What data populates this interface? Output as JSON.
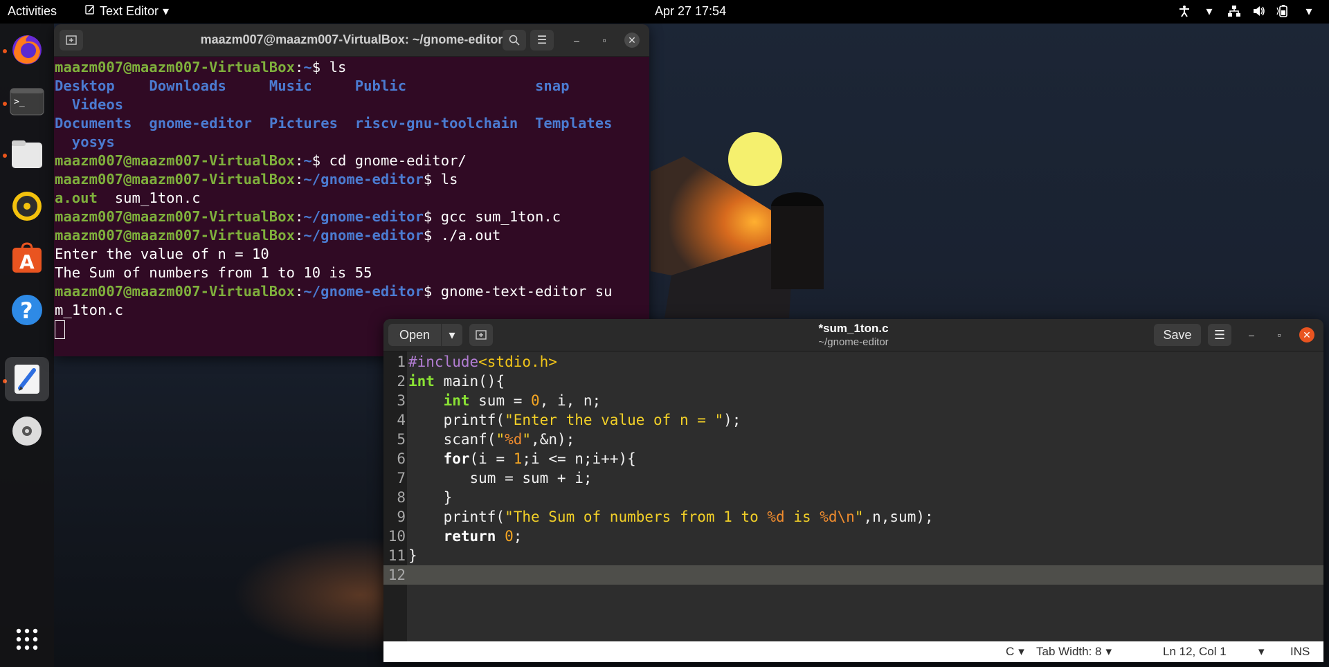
{
  "topbar": {
    "activities": "Activities",
    "app_name": "Text Editor",
    "clock": "Apr 27  17:54"
  },
  "dock": {
    "items": [
      "firefox-icon",
      "terminal-icon",
      "files-icon",
      "rhythmbox-icon",
      "software-icon",
      "help-icon",
      "text-editor-icon",
      "disc-icon",
      "app-grid-icon"
    ]
  },
  "terminal": {
    "title": "maazm007@maazm007-VirtualBox: ~/gnome-editor",
    "prompt_user": "maazm007@maazm007-VirtualBox",
    "home_path": "~",
    "editor_path": "~/gnome-editor",
    "lines": {
      "cmd1": "ls",
      "ls_row1": [
        "Desktop",
        "Downloads",
        "Music",
        "Public",
        "snap"
      ],
      "ls_row1_wrap": "Videos",
      "ls_row2": [
        "Documents",
        "gnome-editor",
        "Pictures",
        "riscv-gnu-toolchain",
        "Templates"
      ],
      "ls_row2_wrap": "yosys",
      "cmd2": "cd gnome-editor/",
      "cmd3": "ls",
      "ls3_exe": "a.out",
      "ls3_file": "sum_1ton.c",
      "cmd4": "gcc sum_1ton.c",
      "cmd5": "./a.out",
      "out1": "Enter the value of n = 10",
      "out2": "The Sum of numbers from 1 to 10 is 55",
      "cmd6": "gnome-text-editor su",
      "cmd6_wrap": "m_1ton.c"
    }
  },
  "editor": {
    "open_label": "Open",
    "save_label": "Save",
    "title": "*sum_1ton.c",
    "subtitle": "~/gnome-editor",
    "status": {
      "language": "C",
      "tab_width": "Tab Width: 8",
      "position": "Ln 12, Col 1",
      "mode": "INS"
    },
    "line_numbers": [
      "1",
      "2",
      "3",
      "4",
      "5",
      "6",
      "7",
      "8",
      "9",
      "10",
      "11",
      "12"
    ]
  }
}
